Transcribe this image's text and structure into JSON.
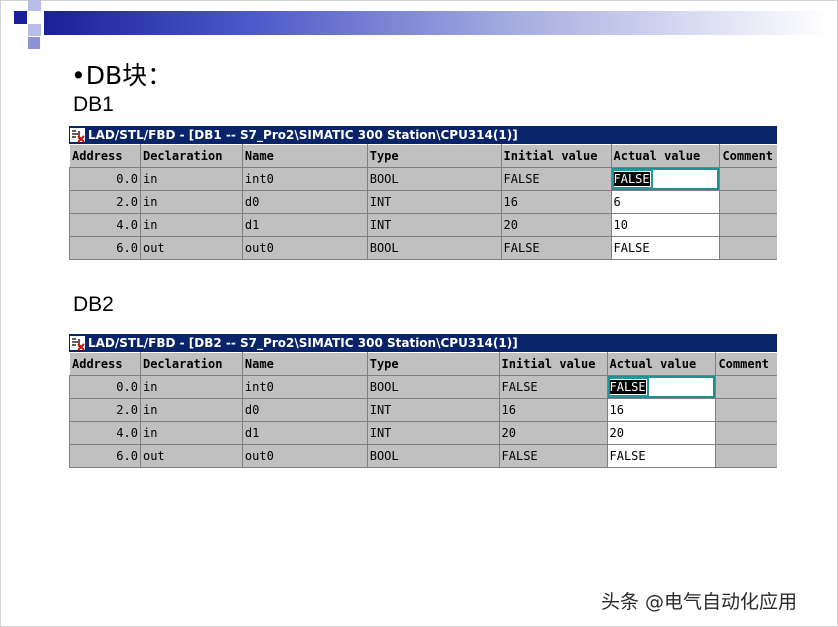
{
  "slide": {
    "heading": "•DB块：",
    "db1_label": "DB1",
    "db2_label": "DB2",
    "watermark": "头条 @电气自动化应用"
  },
  "colors": {
    "titlebar": "#0a246a",
    "topbar_start": "#1a1f9a",
    "grid_gray": "#c0c0c0"
  },
  "headers": [
    "Address",
    "Declaration",
    "Name",
    "Type",
    "Initial value",
    "Actual value",
    "Comment"
  ],
  "db1": {
    "title": "LAD/STL/FBD  - [DB1 -- S7_Pro2\\SIMATIC 300 Station\\CPU314(1)]",
    "rows": [
      {
        "address": "0.0",
        "declaration": "in",
        "name": "int0",
        "type": "BOOL",
        "initial": "FALSE",
        "actual": "FALSE",
        "comment": ""
      },
      {
        "address": "2.0",
        "declaration": "in",
        "name": "d0",
        "type": "INT",
        "initial": "16",
        "actual": "6",
        "comment": ""
      },
      {
        "address": "4.0",
        "declaration": "in",
        "name": "d1",
        "type": "INT",
        "initial": "20",
        "actual": "10",
        "comment": ""
      },
      {
        "address": "6.0",
        "declaration": "out",
        "name": "out0",
        "type": "BOOL",
        "initial": "FALSE",
        "actual": "FALSE",
        "comment": ""
      }
    ]
  },
  "db2": {
    "title": "LAD/STL/FBD  - [DB2 -- S7_Pro2\\SIMATIC 300 Station\\CPU314(1)]",
    "rows": [
      {
        "address": "0.0",
        "declaration": "in",
        "name": "int0",
        "type": "BOOL",
        "initial": "FALSE",
        "actual": "FALSE",
        "comment": ""
      },
      {
        "address": "2.0",
        "declaration": "in",
        "name": "d0",
        "type": "INT",
        "initial": "16",
        "actual": "16",
        "comment": ""
      },
      {
        "address": "4.0",
        "declaration": "in",
        "name": "d1",
        "type": "INT",
        "initial": "20",
        "actual": "20",
        "comment": ""
      },
      {
        "address": "6.0",
        "declaration": "out",
        "name": "out0",
        "type": "BOOL",
        "initial": "FALSE",
        "actual": "FALSE",
        "comment": ""
      }
    ]
  }
}
